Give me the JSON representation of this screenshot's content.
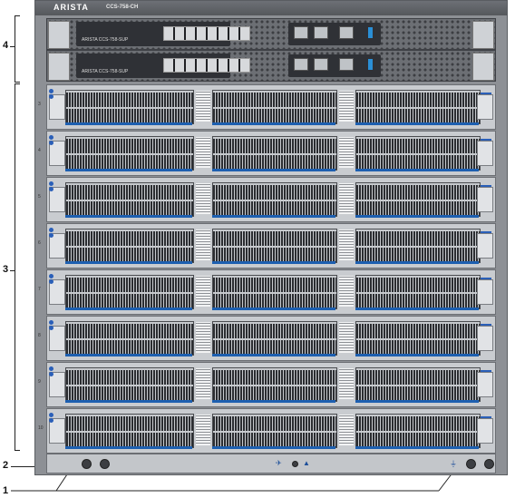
{
  "callouts": {
    "one": "1",
    "two": "2",
    "three": "3",
    "four": "4"
  },
  "chassis": {
    "brand": "ARISTA",
    "model": "CCS-758-CH"
  },
  "supervisors": [
    {
      "label": "ARISTA  CCS-758-SUP"
    },
    {
      "label": "ARISTA  CCS-758-SUP"
    }
  ],
  "linecards": [
    {
      "slot": "3"
    },
    {
      "slot": "4"
    },
    {
      "slot": "5"
    },
    {
      "slot": "6"
    },
    {
      "slot": "7"
    },
    {
      "slot": "8"
    },
    {
      "slot": "9"
    },
    {
      "slot": "10"
    }
  ],
  "icons": {
    "fan": "fan-icon",
    "warning": "warning-icon",
    "ground": "ground-icon"
  },
  "colors": {
    "chassis": "#8d9095",
    "accent": "#1d5fb0"
  }
}
